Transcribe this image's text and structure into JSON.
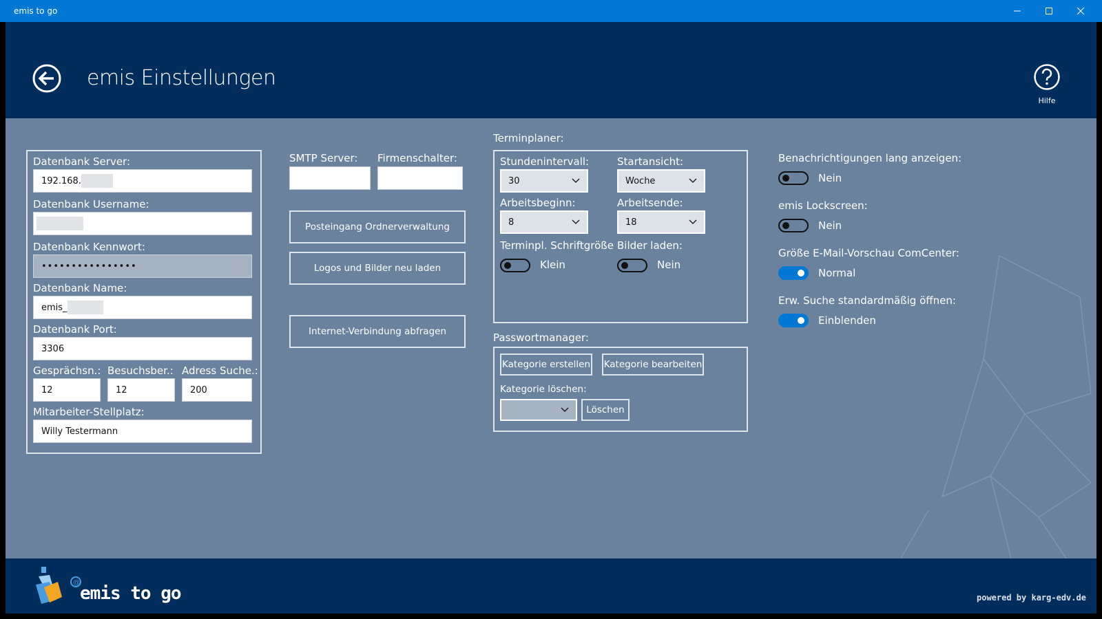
{
  "window": {
    "title": "emis to go"
  },
  "header": {
    "title": "emis Einstellungen",
    "help_label": "Hilfe"
  },
  "database": {
    "server_label": "Datenbank Server:",
    "server_value": "192.168.",
    "username_label": "Datenbank Username:",
    "username_value": "",
    "password_label": "Datenbank Kennwort:",
    "password_value": "••••••••••••••••",
    "name_label": "Datenbank Name:",
    "name_value": "emis_",
    "port_label": "Datenbank Port:",
    "port_value": "3306",
    "gespraechsn_label": "Gesprächsn.:",
    "gespraechsn_value": "12",
    "besuchsber_label": "Besuchsber.:",
    "besuchsber_value": "12",
    "adress_label": "Adress Suche.:",
    "adress_value": "200",
    "stellplatz_label": "Mitarbeiter-Stellplatz:",
    "stellplatz_value": "Willy Testermann"
  },
  "middle": {
    "smtp_label": "SMTP Server:",
    "smtp_value": "",
    "firmenschalter_label": "Firmenschalter:",
    "firmenschalter_value": "",
    "btn_posteingang": "Posteingang Ordnerverwaltung",
    "btn_logos": "Logos und Bilder neu laden",
    "btn_internet": "Internet-Verbindung abfragen"
  },
  "terminplaner": {
    "heading": "Terminplaner:",
    "stundenintervall_label": "Stundenintervall:",
    "stundenintervall_value": "30",
    "startansicht_label": "Startansicht:",
    "startansicht_value": "Woche",
    "arbeitsbeginn_label": "Arbeitsbeginn:",
    "arbeitsbeginn_value": "8",
    "arbeitsende_label": "Arbeitsende:",
    "arbeitsende_value": "18",
    "schriftgroesse_label": "Terminpl. Schriftgröße",
    "schriftgroesse_value": "Klein",
    "bilder_label": "Bilder laden:",
    "bilder_value": "Nein"
  },
  "passwortmanager": {
    "heading": "Passwortmanager:",
    "btn_erstellen": "Kategorie erstellen",
    "btn_bearbeiten": "Kategorie bearbeiten",
    "loeschen_label": "Kategorie löschen:",
    "loeschen_value": "",
    "btn_loeschen": "Löschen"
  },
  "right": {
    "benachrichtigungen_label": "Benachrichtigungen lang anzeigen:",
    "benachrichtigungen_value": "Nein",
    "lockscreen_label": "emis Lockscreen:",
    "lockscreen_value": "Nein",
    "vorschau_label": "Größe E-Mail-Vorschau ComCenter:",
    "vorschau_value": "Normal",
    "suche_label": "Erw. Suche standardmäßig öffnen:",
    "suche_value": "Einblenden"
  },
  "footer": {
    "brand": "emis to go",
    "powered": "powered by karg-edv.de"
  },
  "colors": {
    "accent": "#0078d4",
    "header": "#002d5c",
    "content": "#6a829e"
  }
}
